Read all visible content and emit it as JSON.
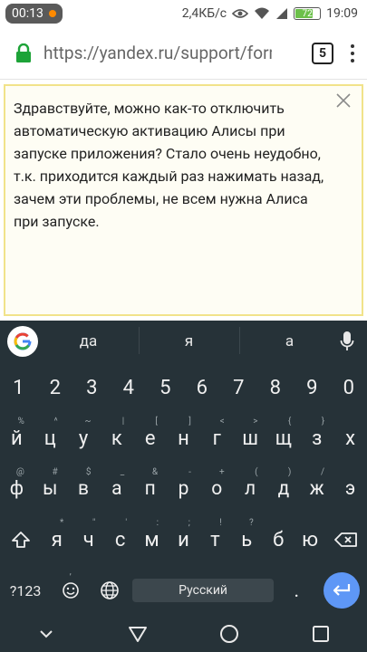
{
  "status": {
    "time": "00:13",
    "speed": "2,4КБ/с",
    "battery": "72",
    "battery_level_percent": 72,
    "clock": "19:09"
  },
  "browser": {
    "url": "https://yandex.ru/support/form/",
    "tab_count": "5"
  },
  "form": {
    "message": "Здравствуйте, можно как-то отключить автоматическую активацию Алисы при запуске приложения? Стало очень неудобно, т.к. приходится каждый раз нажимать назад, зачем эти проблемы, не всем нужна Алиса при запуске."
  },
  "keyboard": {
    "suggestions": [
      "да",
      "я",
      "а"
    ],
    "digits": [
      "1",
      "2",
      "3",
      "4",
      "5",
      "6",
      "7",
      "8",
      "9",
      "0"
    ],
    "row1": [
      {
        "k": "й",
        "h": "%"
      },
      {
        "k": "ц",
        "h": "^"
      },
      {
        "k": "у",
        "h": "~"
      },
      {
        "k": "к",
        "h": "|"
      },
      {
        "k": "е",
        "h": "["
      },
      {
        "k": "н",
        "h": "]"
      },
      {
        "k": "г",
        "h": "<"
      },
      {
        "k": "ш",
        "h": ">"
      },
      {
        "k": "щ",
        "h": "{"
      },
      {
        "k": "з",
        "h": "}"
      },
      {
        "k": "х",
        "h": ""
      }
    ],
    "row2": [
      {
        "k": "ф",
        "h": "@"
      },
      {
        "k": "ы",
        "h": "#"
      },
      {
        "k": "в",
        "h": "$"
      },
      {
        "k": "а",
        "h": "_"
      },
      {
        "k": "п",
        "h": "&"
      },
      {
        "k": "р",
        "h": "-"
      },
      {
        "k": "о",
        "h": "+"
      },
      {
        "k": "л",
        "h": "("
      },
      {
        "k": "д",
        "h": ")"
      },
      {
        "k": "ж",
        "h": "/"
      },
      {
        "k": "э",
        "h": ""
      }
    ],
    "row3": [
      {
        "k": "я",
        "h": "*"
      },
      {
        "k": "ч",
        "h": "\""
      },
      {
        "k": "с",
        "h": "'"
      },
      {
        "k": "м",
        "h": ":"
      },
      {
        "k": "и",
        "h": ";"
      },
      {
        "k": "т",
        "h": "!"
      },
      {
        "k": "ь",
        "h": "?"
      },
      {
        "k": "б",
        "h": ""
      },
      {
        "k": "ю",
        "h": ""
      }
    ],
    "symbols_key": "?123",
    "emoji_hint": ",",
    "space_label": "Русский",
    "period_key": ".",
    "period_hint": ""
  }
}
